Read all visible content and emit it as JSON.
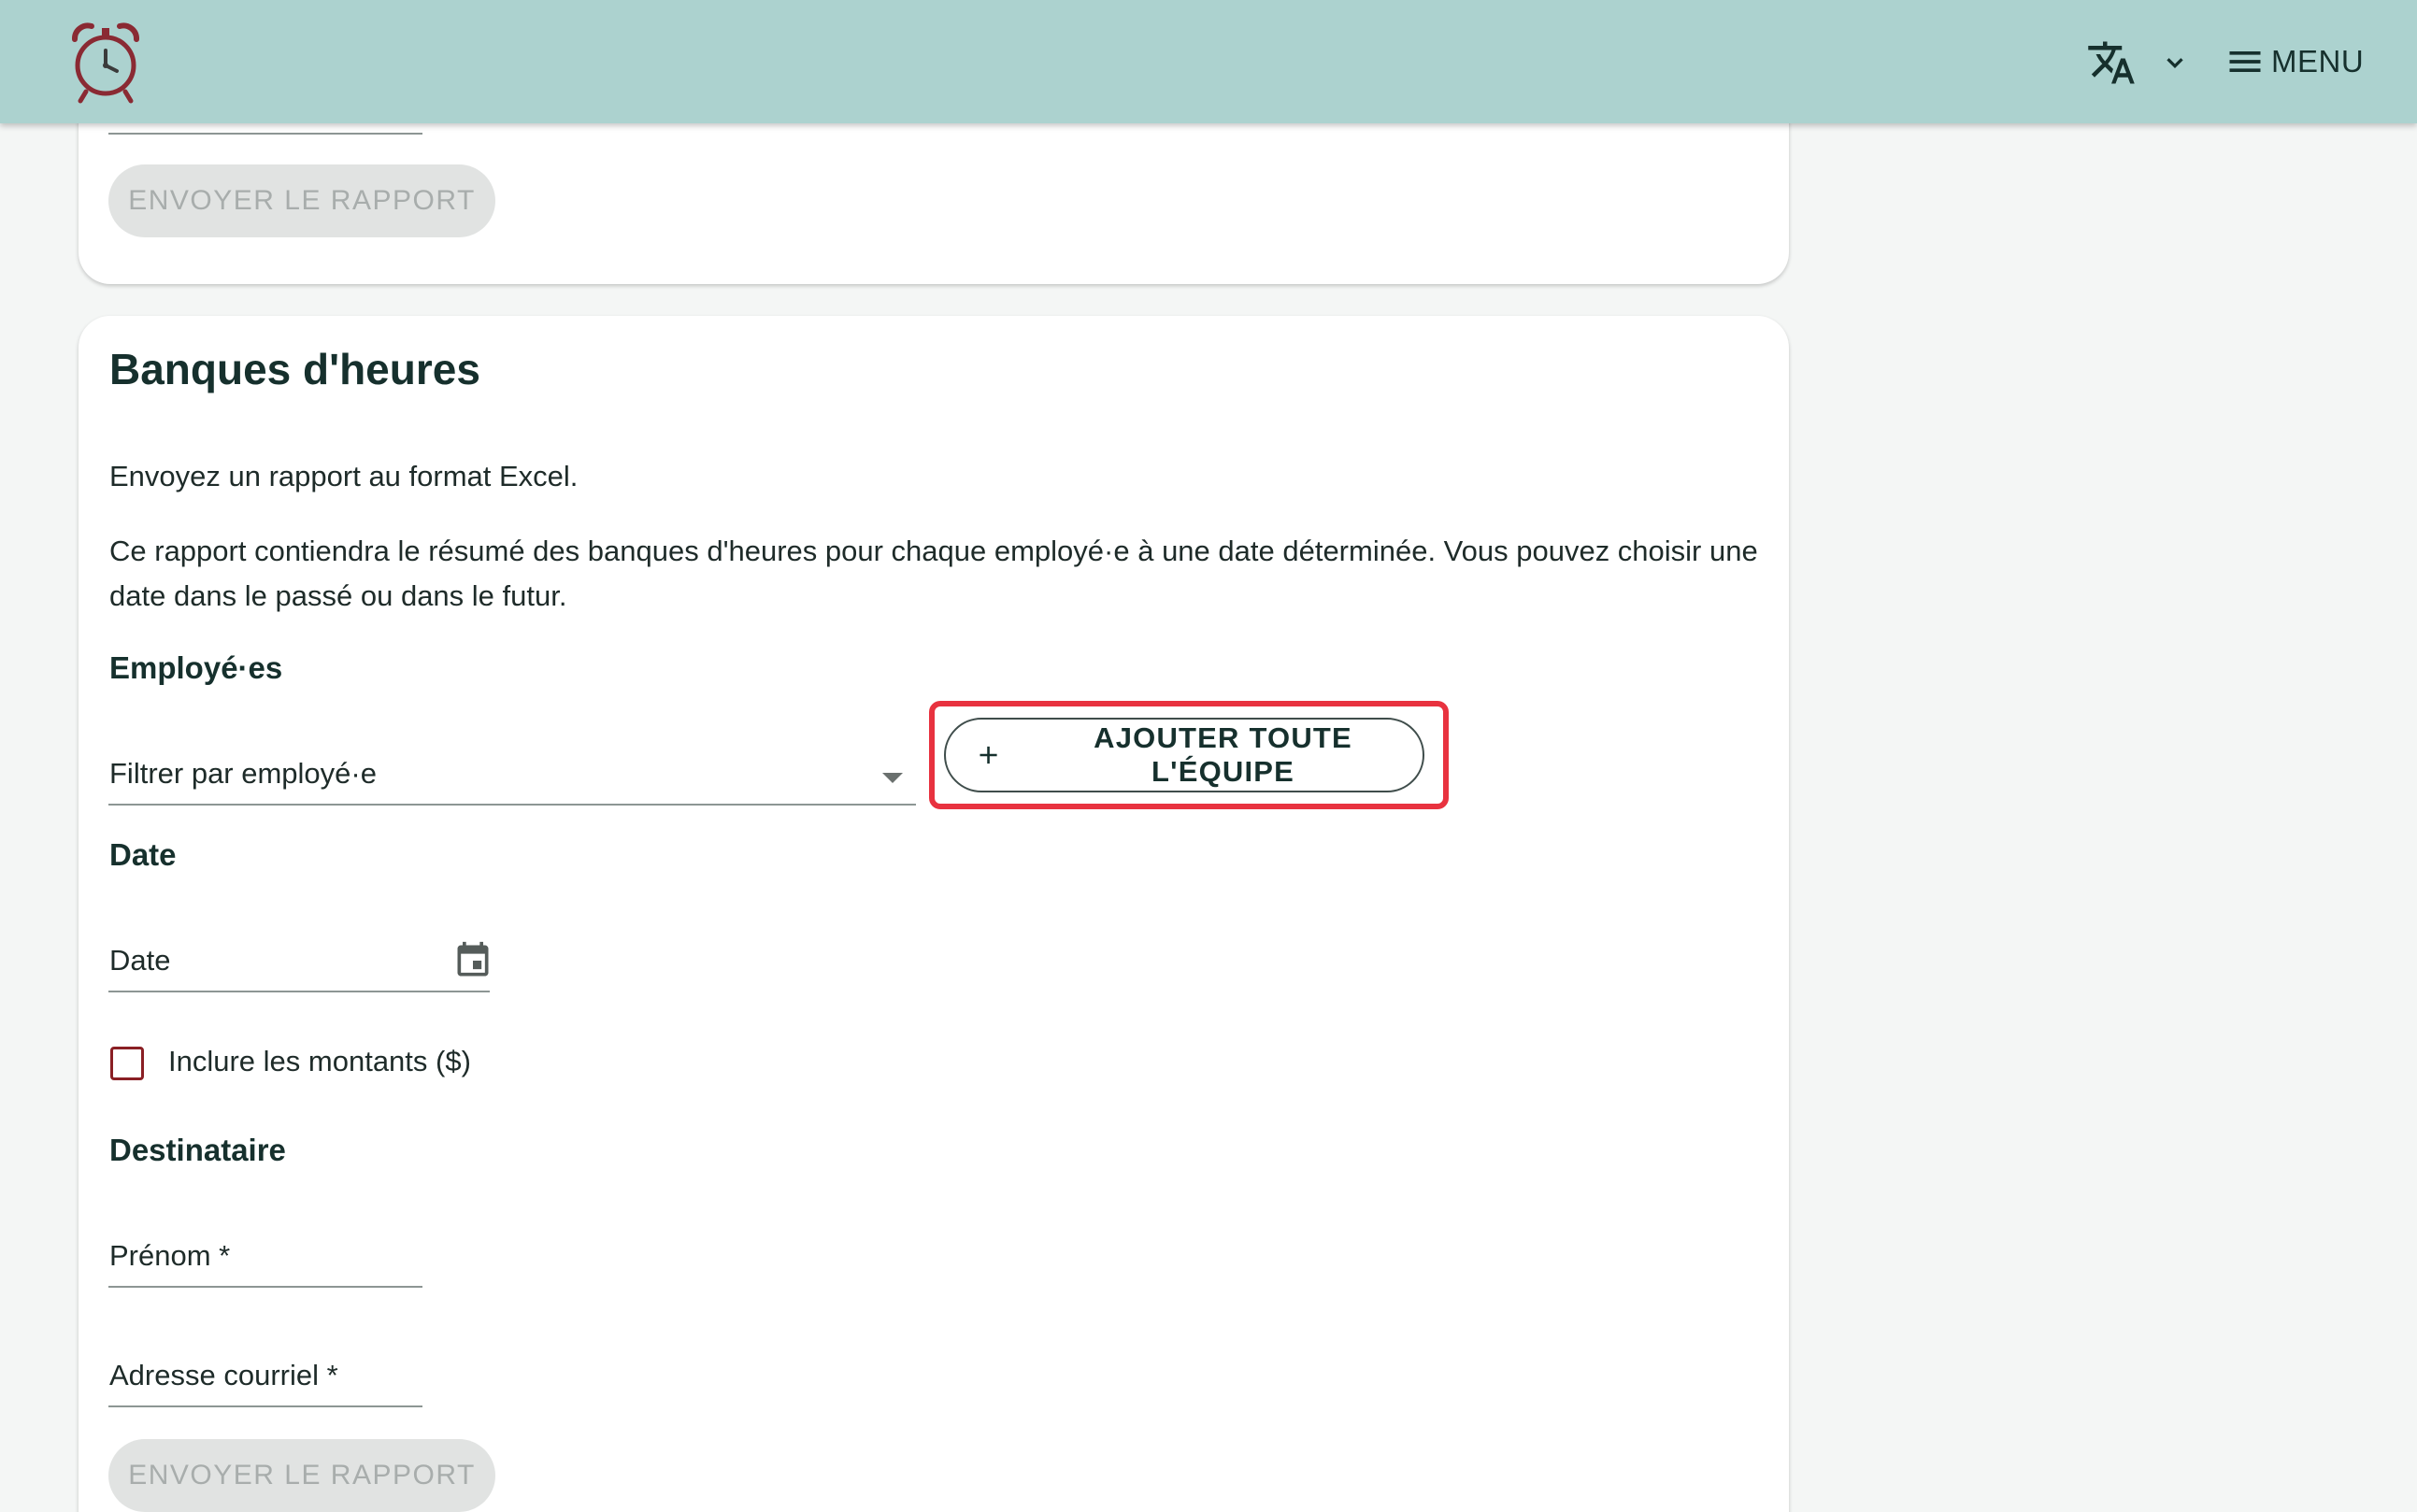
{
  "header": {
    "logo_icon": "alarm-clock-icon",
    "language_icon": "translate-icon",
    "language_chevron_icon": "chevron-down-icon",
    "menu_icon": "hamburger-menu-icon",
    "menu_label": "MENU",
    "bar_color": "#acd2cf"
  },
  "top_card": {
    "send_button_label": "ENVOYER LE RAPPORT"
  },
  "hour_banks": {
    "title": "Banques d'heures",
    "intro": "Envoyez un rapport au format Excel.",
    "description": "Ce rapport contiendra le résumé des banques d'heures pour chaque employé·e à une date déterminée. Vous pouvez choisir une date dans le passé ou dans le futur.",
    "employees_label": "Employé·es",
    "employee_filter_placeholder": "Filtrer par employé·e",
    "add_team_button_label": "AJOUTER TOUTE L'ÉQUIPE",
    "date_label": "Date",
    "date_field_placeholder": "Date",
    "include_amounts_label": "Inclure les montants ($)",
    "include_amounts_checked": false,
    "recipient_label": "Destinataire",
    "first_name_placeholder": "Prénom *",
    "email_placeholder": "Adresse courriel *",
    "send_button_label": "ENVOYER LE RAPPORT",
    "highlight_color": "#e8323f",
    "checkbox_color": "#8a1f24"
  }
}
